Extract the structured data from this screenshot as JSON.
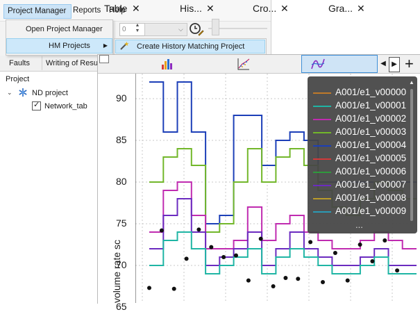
{
  "menubar": {
    "items": [
      "Project Manager",
      "Reports",
      "Help"
    ]
  },
  "project_menu": {
    "items": [
      {
        "label": "Open Project Manager"
      },
      {
        "label": "HM Projects",
        "has_submenu": true
      }
    ]
  },
  "hm_submenu": {
    "items": [
      {
        "label": "Create History Matching Project"
      }
    ]
  },
  "toolbar": {
    "spin_value": "0"
  },
  "left_tabs": [
    "Faults",
    "Writing of Resu"
  ],
  "project_panel": {
    "title": "Project",
    "tree": [
      {
        "label": "ND project",
        "expanded": true
      },
      {
        "label": "Network_tab",
        "checked": true
      }
    ]
  },
  "graph_tabs": [
    {
      "label": "Table",
      "close": "✕"
    },
    {
      "label": "His...",
      "close": "✕"
    },
    {
      "label": "Cro...",
      "close": "✕"
    },
    {
      "label": "Gra...",
      "close": "✕",
      "active": true
    }
  ],
  "chart_data": {
    "type": "line",
    "ylabel": "volume rate sc",
    "ytick_labels": [
      "90",
      "85",
      "80",
      "75",
      "70",
      "65"
    ],
    "ylim": [
      65.5,
      93.0
    ],
    "grid": true,
    "legend": {
      "placement": "top-right",
      "entries": [
        {
          "name": "A001/e1_v00000",
          "color": "#c07a2a"
        },
        {
          "name": "A001/e1_v00001",
          "color": "#1fb5a4"
        },
        {
          "name": "A001/e1_v00002",
          "color": "#c02bb0"
        },
        {
          "name": "A001/e1_v00003",
          "color": "#72b72a"
        },
        {
          "name": "A001/e1_v00004",
          "color": "#1c3fb8"
        },
        {
          "name": "A001/e1_v00005",
          "color": "#d23a3a"
        },
        {
          "name": "A001/e1_v00006",
          "color": "#2f9a3c"
        },
        {
          "name": "A001/e1_v00007",
          "color": "#6b2bc0"
        },
        {
          "name": "A001/e1_v00008",
          "color": "#b99b2a"
        },
        {
          "name": "A001/e1_v00009",
          "color": "#2a9ab5"
        }
      ],
      "more": "..."
    },
    "series": [
      {
        "name": "A001/e1_v00004",
        "color": "#1c3fb8",
        "values": [
          92,
          86,
          92,
          86,
          75,
          76,
          88,
          88,
          82,
          85,
          86,
          85,
          80,
          80,
          80,
          80,
          80,
          80,
          80
        ]
      },
      {
        "name": "A001/e1_v00003",
        "color": "#72b72a",
        "values": [
          80,
          83,
          84,
          82,
          74,
          75,
          80,
          84,
          80,
          83,
          84,
          82,
          79,
          77,
          76,
          78,
          80,
          79,
          78
        ]
      },
      {
        "name": "A001/e1_v00002",
        "color": "#c02bb0",
        "values": [
          74,
          79,
          80,
          76,
          72,
          72,
          73,
          77,
          73,
          75,
          76,
          74,
          73,
          72,
          72,
          73,
          74,
          73,
          72
        ]
      },
      {
        "name": "A001/e1_v00007",
        "color": "#6b2bc0",
        "values": [
          72,
          76,
          78,
          74,
          70,
          71,
          72,
          74,
          70,
          72,
          74,
          72,
          71,
          70,
          70,
          71,
          72,
          70,
          70
        ]
      },
      {
        "name": "A001/e1_v00001",
        "color": "#1fb5a4",
        "values": [
          70,
          73,
          74,
          72,
          69,
          70,
          71,
          72,
          69,
          71,
          72,
          71,
          70,
          69,
          69,
          70,
          71,
          69,
          69
        ]
      }
    ],
    "observed_points": {
      "name": "observed",
      "color": "#111111",
      "values": [
        67.3,
        74.2,
        67.2,
        70.8,
        74.3,
        72.2,
        71.0,
        71.2,
        68.2,
        73.2,
        67.5,
        68.5,
        68.4,
        72.8,
        68.0,
        71.5,
        68.2,
        72.5,
        70.5,
        73.0,
        69.4
      ]
    }
  }
}
